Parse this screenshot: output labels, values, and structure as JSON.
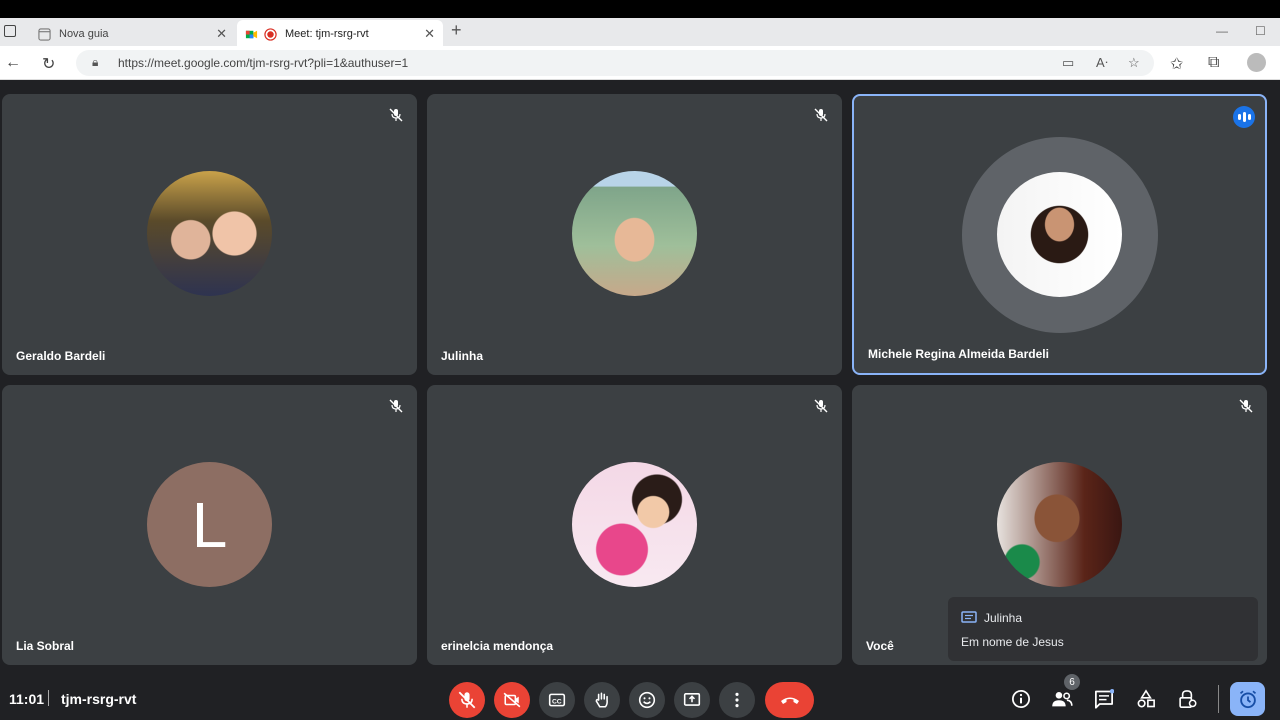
{
  "browser": {
    "tabs": [
      {
        "title": "Nova guia",
        "active": false
      },
      {
        "title": "Meet: tjm-rsrg-rvt",
        "active": true
      }
    ],
    "url": "https://meet.google.com/tjm-rsrg-rvt?pli=1&authuser=1"
  },
  "participants": [
    {
      "name": "Geraldo Bardeli",
      "muted": true,
      "speaking": false,
      "avatar": "photo"
    },
    {
      "name": "Julinha",
      "muted": true,
      "speaking": false,
      "avatar": "photo"
    },
    {
      "name": "Michele Regina Almeida Bardeli",
      "muted": false,
      "speaking": true,
      "avatar": "photo"
    },
    {
      "name": "Lia Sobral",
      "muted": true,
      "speaking": false,
      "avatar": "letter",
      "letter": "L"
    },
    {
      "name": "erinelcia mendonça",
      "muted": true,
      "speaking": false,
      "avatar": "photo"
    },
    {
      "name": "Você",
      "muted": true,
      "speaking": false,
      "avatar": "photo"
    }
  ],
  "chat_notification": {
    "sender": "Julinha",
    "message": "Em nome de Jesus"
  },
  "bottom_bar": {
    "time": "11:01",
    "meeting_code": "tjm-rsrg-rvt",
    "people_count": "6"
  },
  "colors": {
    "accent": "#8ab4f8",
    "danger": "#ea4335",
    "tile": "#3c4043",
    "background": "#202124"
  }
}
